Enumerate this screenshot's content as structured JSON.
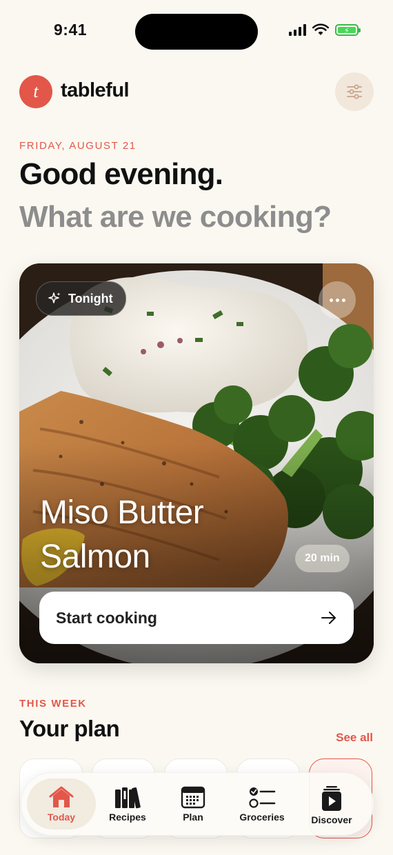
{
  "status_bar": {
    "time": "9:41"
  },
  "header": {
    "logo_letter": "t",
    "brand": "tableful",
    "filter_icon": "sliders-icon"
  },
  "greeting": {
    "date": "FRIDAY, AUGUST 21",
    "title": "Good evening.",
    "subtitle": "What are we cooking?"
  },
  "hero": {
    "badge": "Tonight",
    "badge_icon": "sparkle-icon",
    "dish_line1": "Miso Butter",
    "dish_line2": "Salmon",
    "duration": "20 min",
    "cta": "Start cooking",
    "cta_icon": "arrow-right-icon",
    "more_icon": "more-icon"
  },
  "week": {
    "label": "THIS WEEK",
    "title": "Your plan",
    "see_all": "See all"
  },
  "tabs": [
    {
      "label": "Today",
      "icon": "home-icon",
      "active": true
    },
    {
      "label": "Recipes",
      "icon": "books-icon",
      "active": false
    },
    {
      "label": "Plan",
      "icon": "calendar-icon",
      "active": false
    },
    {
      "label": "Groceries",
      "icon": "checklist-icon",
      "active": false
    },
    {
      "label": "Discover",
      "icon": "play-icon",
      "active": false
    }
  ],
  "colors": {
    "accent": "#E2574A",
    "background": "#FBF8F1",
    "muted": "#8D8D8D"
  }
}
